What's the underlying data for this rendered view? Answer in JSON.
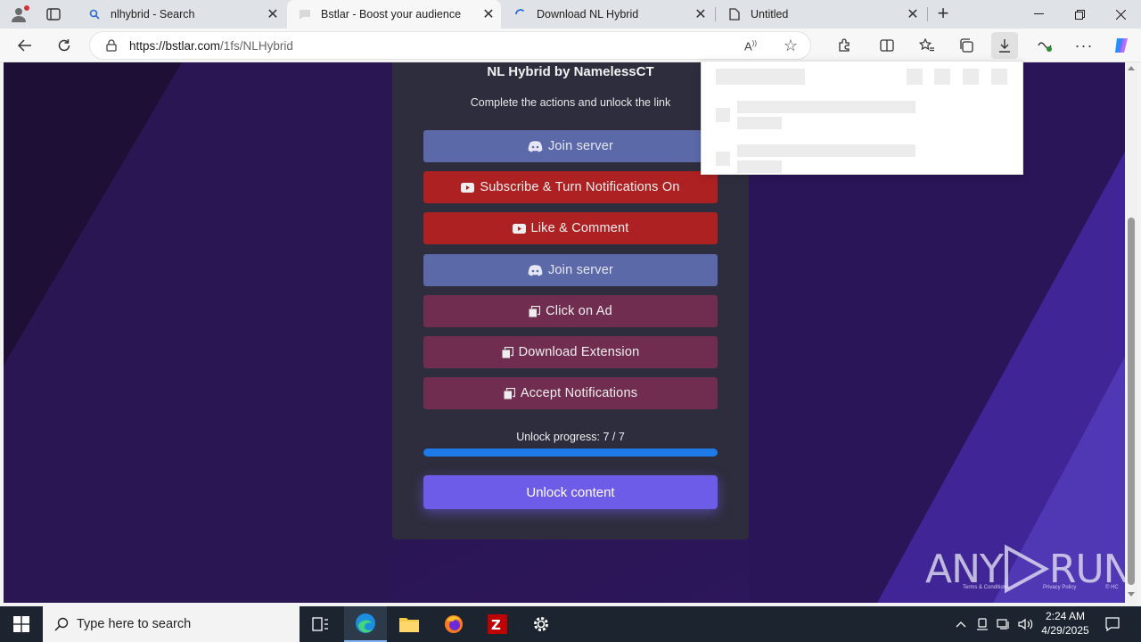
{
  "browser": {
    "tabs": [
      {
        "title": "nlhybrid - Search",
        "favicon": "search-icon"
      },
      {
        "title": "Bstlar - Boost your audience",
        "favicon": "bstlar-icon",
        "active": true
      },
      {
        "title": "Download NL Hybrid",
        "favicon": "loading-icon"
      },
      {
        "title": "Untitled",
        "favicon": "page-icon"
      }
    ],
    "new_tab": "+",
    "address": "https://bstlar.com/1fs/NLHybrid",
    "address_host": "https://bstlar.com",
    "address_path": "/1fs/NLHybrid"
  },
  "page": {
    "title": "NL Hybrid by NamelessCT",
    "subtitle": "Complete the actions and unlock the link",
    "actions": [
      {
        "label": "Join server",
        "icon": "discord-icon",
        "color": "#5c69a9"
      },
      {
        "label": "Subscribe & Turn Notifications On",
        "icon": "youtube-icon",
        "color": "#ae2122"
      },
      {
        "label": "Like & Comment",
        "icon": "youtube-icon",
        "color": "#ae2122"
      },
      {
        "label": "Join server",
        "icon": "discord-icon",
        "color": "#5c69a9"
      },
      {
        "label": "Click on Ad",
        "icon": "copy-icon",
        "color": "#702d4f"
      },
      {
        "label": "Download Extension",
        "icon": "copy-icon",
        "color": "#702d4f"
      },
      {
        "label": "Accept Notifications",
        "icon": "copy-icon",
        "color": "#702d4f"
      }
    ],
    "progress_label": "Unlock progress: 7 / 7",
    "progress_value": 1.0,
    "unlock_button": "Unlock content",
    "footer_links": [
      "Terms & Conditions",
      "Privacy Policy",
      "© HC"
    ]
  },
  "watermark": {
    "text_left": "ANY",
    "text_right": "RUN"
  },
  "taskbar": {
    "search_placeholder": "Type here to search",
    "time": "2:24 AM",
    "date": "4/29/2025"
  },
  "colors": {
    "accent_unlock": "#6c5ce7",
    "progress_bar": "#1e7ae8",
    "card_bg": "#2d2d3d"
  }
}
